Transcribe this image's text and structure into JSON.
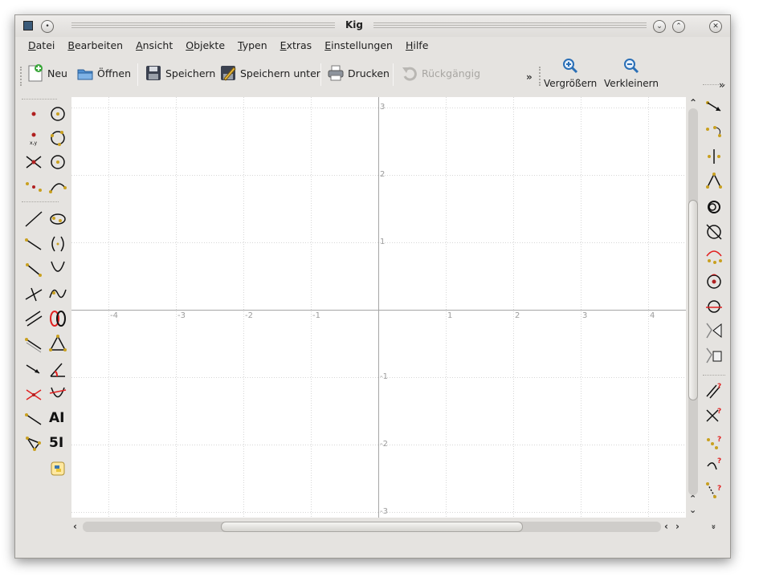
{
  "window": {
    "title": "Kig"
  },
  "menubar": {
    "items": [
      "Datei",
      "Bearbeiten",
      "Ansicht",
      "Objekte",
      "Typen",
      "Extras",
      "Einstellungen",
      "Hilfe"
    ]
  },
  "toolbar": {
    "new_label": "Neu",
    "open_label": "Öffnen",
    "save_label": "Speichern",
    "save_as_label": "Speichern unter",
    "print_label": "Drucken",
    "undo_label": "Rückgängig",
    "zoom_in_label": "Vergrößern",
    "zoom_out_label": "Verkleinern",
    "overflow_label": "»"
  },
  "canvas": {
    "x_ticks": [
      "-4",
      "-3",
      "-2",
      "-1",
      "1",
      "2",
      "3",
      "4"
    ],
    "y_ticks": [
      "3",
      "2",
      "1",
      "-1",
      "-2",
      "-3"
    ]
  },
  "left_tools": {
    "icons": [
      "point-icon",
      "circle-center-point-icon",
      "point-by-coords-icon",
      "circle-three-points-icon",
      "intersection-point-icon",
      "circle-center-radius-icon",
      "midpoint-icon",
      "arc-three-points-icon",
      "line-icon",
      "conic-five-points-icon",
      "ray-icon",
      "hyperbola-icon",
      "segment-icon",
      "parabola-icon",
      "perpendicular-icon",
      "cubic-icon",
      "parallel-icon",
      "locus-icon",
      "segment-length-icon",
      "triangle-icon",
      "vector-icon",
      "angle-icon",
      "line-intersection-icon",
      "conic-tangent-icon",
      "bisector-icon",
      "text-label-icon",
      "polygon-icon",
      "numeric-label-icon",
      "python-script-icon"
    ],
    "text_label": "AI",
    "number_label": "5I"
  },
  "right_tools": {
    "icons": [
      "translate-icon",
      "rotate-icon",
      "reflect-point-icon",
      "reflect-line-icon",
      "homothety-icon",
      "inversion-icon",
      "arc-transform-icon",
      "circle-transform-icon",
      "circle-line-icon",
      "projective-icon",
      "affine-icon",
      "parallel-test-icon",
      "orthogonal-test-icon",
      "collinear-test-icon",
      "contains-test-icon",
      "distance-test-icon"
    ],
    "expand_label": "»"
  },
  "colors": {
    "window_bg": "#e5e3e0",
    "canvas_bg": "#ffffff",
    "grid": "#d6d6d6",
    "axis": "#a5a5a5",
    "tick_text": "#9c9c9c",
    "accent_red": "#e02020",
    "accent_blue": "#2a6fb6"
  }
}
